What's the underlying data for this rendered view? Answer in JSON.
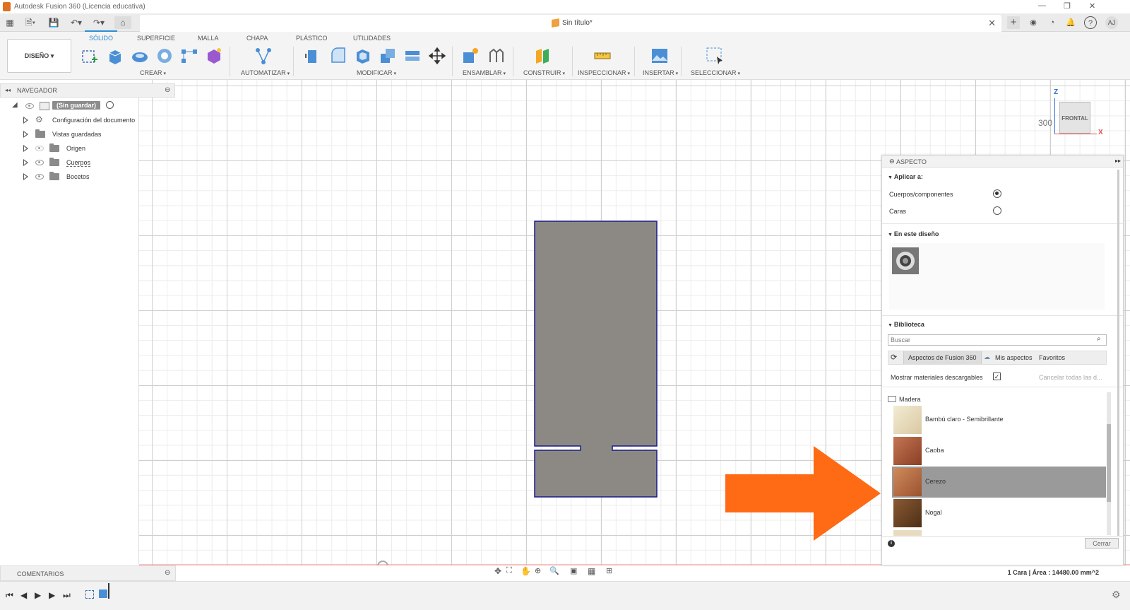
{
  "window": {
    "title": "Autodesk Fusion 360 (Licencia educativa)",
    "document_tab": "Sin título*",
    "user_initials": "AJ"
  },
  "toolbar": {
    "workspace": "DISEÑO",
    "tabs": [
      "SÓLIDO",
      "SUPERFICIE",
      "MALLA",
      "CHAPA",
      "PLÁSTICO",
      "UTILIDADES"
    ],
    "groups": [
      "CREAR",
      "AUTOMATIZAR",
      "MODIFICAR",
      "ENSAMBLAR",
      "CONSTRUIR",
      "INSPECCIONAR",
      "INSERTAR",
      "SELECCIONAR"
    ]
  },
  "navigator": {
    "title": "NAVEGADOR",
    "root": "(Sin guardar)",
    "items": [
      "Configuración del documento",
      "Vistas guardadas",
      "Origen",
      "Cuerpos",
      "Bocetos"
    ]
  },
  "viewcube": {
    "face": "FRONTAL",
    "axis_z": "Z",
    "axis_x": "X",
    "scale_label": "300"
  },
  "aspect_panel": {
    "title": "ASPECTO",
    "apply_to_heading": "Aplicar a:",
    "option_bodies": "Cuerpos/componentes",
    "option_faces": "Caras",
    "selected_option": "Cuerpos/componentes",
    "in_design_heading": "En este diseño",
    "library_heading": "Biblioteca",
    "search_placeholder": "Buscar",
    "library_tabs": [
      "Aspectos de Fusion 360",
      "Mis aspectos",
      "Favoritos"
    ],
    "show_downloadable": "Mostrar materiales descargables",
    "show_downloadable_checked": true,
    "cancel_all": "Cancelar todas las d...",
    "folder": "Madera",
    "materials": [
      {
        "name": "Bambú claro - Semibrillante",
        "color": "#e8dcc0",
        "selected": false
      },
      {
        "name": "Caoba",
        "color": "#a85a3a",
        "selected": false
      },
      {
        "name": "Cerezo",
        "color": "#b46a42",
        "selected": true
      },
      {
        "name": "Nogal",
        "color": "#6e4626",
        "selected": false
      }
    ],
    "close_button": "Cerrar"
  },
  "comments": {
    "title": "COMENTARIOS"
  },
  "status_bar": {
    "text": "1 Cara | Área : 14480.00 mm^2"
  },
  "colors": {
    "accent": "#2b8fd4",
    "sketch_fill": "#8c8984",
    "sketch_outline": "#1a1a8a",
    "annotation_arrow": "#ff6a14",
    "selection_row": "#9a9a9a"
  }
}
